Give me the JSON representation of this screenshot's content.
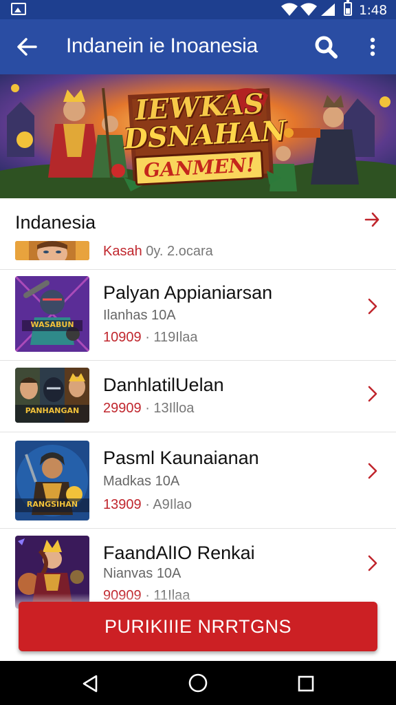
{
  "status_bar": {
    "time": "1:48",
    "icons": [
      "gallery-icon",
      "wifi-icon",
      "wifi-icon",
      "signal-icon",
      "battery-icon"
    ]
  },
  "app_bar": {
    "title": "Indanein ie Inoanesia",
    "icons": [
      "back-arrow-icon",
      "search-icon",
      "more-vert-icon"
    ]
  },
  "banner": {
    "line1": "IEWKAS",
    "line2": "DSNAHAN",
    "line3": "GANMEN!"
  },
  "section": {
    "title": "Indanesia",
    "featured": {
      "label": "Kasah",
      "meta": "0y. 2.ocara"
    }
  },
  "items": [
    {
      "name": "Palyan Appianiarsan",
      "sub": "Ilanhas 10A",
      "downloads": "10909",
      "size": "119Ilaa",
      "thumb_label": "WASABUN"
    },
    {
      "name": "DanhlatilUelan",
      "sub": "",
      "downloads": "29909",
      "size": "13Illoa",
      "thumb_label": "PANHANGAN"
    },
    {
      "name": "Pasml Kaunaianan",
      "sub": "Madkas 10A",
      "downloads": "13909",
      "size": "A9Ilao",
      "thumb_label": "RANGSIHAN"
    },
    {
      "name": "FaandAlIO Renkai",
      "sub": "Nianvas 10A",
      "downloads": "90909",
      "size": "11Ilaa",
      "thumb_label": ""
    }
  ],
  "separator": "·",
  "action": {
    "label": "PURIKIIIE NRRTGNS"
  },
  "colors": {
    "app_bar": "#2a4da3",
    "status_bar": "#1e3f8f",
    "accent_red": "#cc2024",
    "chevron": "#c0262d"
  }
}
